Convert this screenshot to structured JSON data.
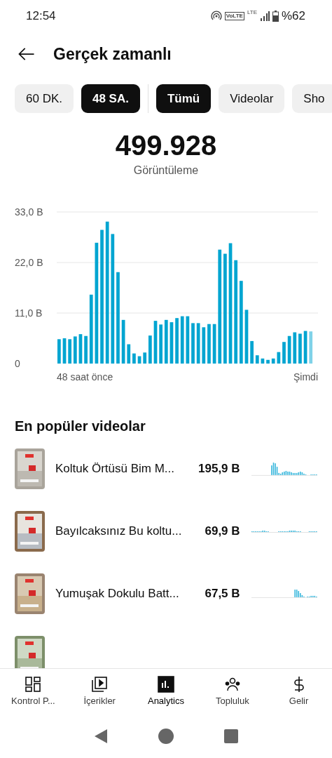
{
  "status_bar": {
    "time": "12:54",
    "volte": "VoLTE",
    "network": "LTE",
    "battery": "%62"
  },
  "header": {
    "title": "Gerçek zamanlı"
  },
  "period_chips": [
    {
      "label": "60 DK.",
      "selected": false
    },
    {
      "label": "48 SA.",
      "selected": true
    }
  ],
  "type_chips": [
    {
      "label": "Tümü",
      "selected": true
    },
    {
      "label": "Videolar",
      "selected": false
    },
    {
      "label": "Sho",
      "selected": false
    }
  ],
  "summary": {
    "value": "499.928",
    "label": "Görüntüleme"
  },
  "chart": {
    "x_labels": [
      "48 saat önce",
      "Şimdi"
    ],
    "chart_data": {
      "type": "bar",
      "ylim": [
        0,
        33
      ],
      "yticks": [
        {
          "value": 0,
          "label": "0"
        },
        {
          "value": 11,
          "label": "11,0 B"
        },
        {
          "value": 22,
          "label": "22,0 B"
        },
        {
          "value": 33,
          "label": "33,0 B"
        }
      ],
      "series": [
        {
          "color": "#00a5d1",
          "values": [
            5.3,
            5.5,
            5.3,
            5.9,
            6.4,
            6.0,
            15.0,
            26.3,
            29.1,
            30.9,
            28.2,
            19.9,
            9.5,
            4.2,
            2.2,
            1.6,
            2.4,
            6.1,
            9.3,
            8.5,
            9.5,
            9.0,
            9.9,
            10.3,
            10.3,
            8.8,
            8.8,
            7.9,
            8.6,
            8.6,
            24.8,
            23.9,
            26.2,
            22.5,
            18.0,
            11.7,
            4.9,
            1.8,
            1.1,
            0.8,
            1.1,
            2.5,
            4.7,
            6.0,
            6.8,
            6.5,
            7.1,
            7.0
          ]
        }
      ]
    }
  },
  "popular": {
    "title": "En popüler videolar",
    "videos": [
      {
        "kind": "video",
        "title": "Koltuk Örtüsü Bim M...",
        "views": "195,9 B"
      },
      {
        "kind": "video",
        "title": "Bayılcaksınız Bu koltu...",
        "views": "69,9 B"
      },
      {
        "kind": "video",
        "title": "Yumuşak Dokulu Batt...",
        "views": "67,5 B"
      },
      {
        "kind": "partial"
      }
    ]
  },
  "bottom_nav": [
    {
      "kind": "dashboard",
      "label": "Kontrol P...",
      "selected": false
    },
    {
      "kind": "content",
      "label": "İçerikler",
      "selected": false
    },
    {
      "kind": "analytics",
      "label": "Analytics",
      "selected": true
    },
    {
      "kind": "community",
      "label": "Topluluk",
      "selected": false
    },
    {
      "kind": "revenue",
      "label": "Gelir",
      "selected": false
    }
  ]
}
